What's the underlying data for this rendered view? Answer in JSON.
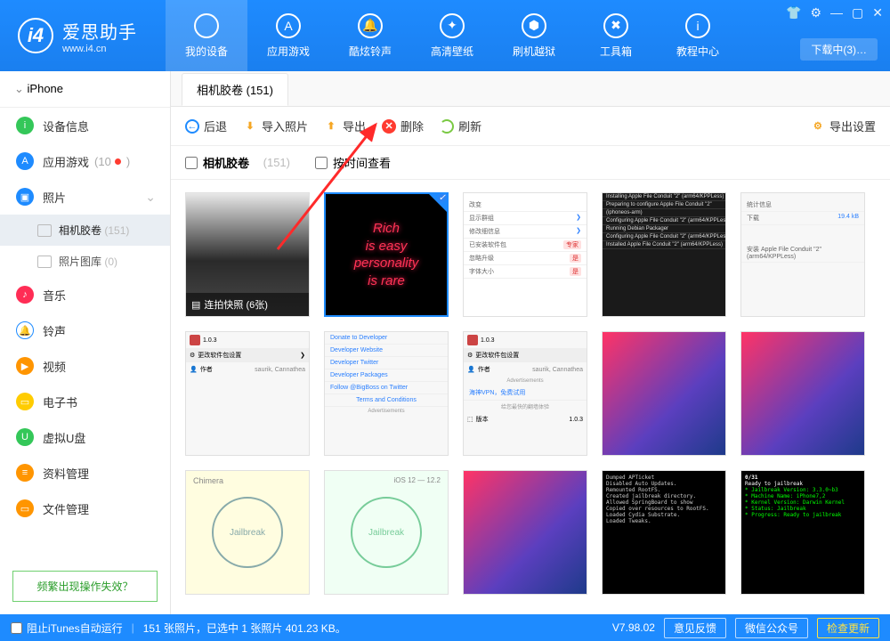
{
  "header": {
    "logo_badge": "i4",
    "logo_cn": "爱思助手",
    "logo_url": "www.i4.cn",
    "tabs": [
      {
        "label": "我的设备"
      },
      {
        "label": "应用游戏"
      },
      {
        "label": "酷炫铃声"
      },
      {
        "label": "高清壁纸"
      },
      {
        "label": "刷机越狱"
      },
      {
        "label": "工具箱"
      },
      {
        "label": "教程中心"
      }
    ],
    "download_pill": "下载中(3)…"
  },
  "sidebar": {
    "device": "iPhone",
    "items": [
      {
        "label": "设备信息",
        "color": "#34c759"
      },
      {
        "label": "应用游戏",
        "color": "#1e8bff",
        "count": "10",
        "dot": true
      },
      {
        "label": "照片",
        "color": "#1e8bff",
        "expandable": true
      },
      {
        "label": "音乐",
        "color": "#ff2d55"
      },
      {
        "label": "铃声",
        "color": "#1e8bff"
      },
      {
        "label": "视频",
        "color": "#ff9500"
      },
      {
        "label": "电子书",
        "color": "#ffcc00"
      },
      {
        "label": "虚拟U盘",
        "color": "#34c759"
      },
      {
        "label": "资料管理",
        "color": "#ff9500"
      },
      {
        "label": "文件管理",
        "color": "#ff9500"
      }
    ],
    "subs": [
      {
        "label": "相机胶卷",
        "count": "(151)",
        "active": true
      },
      {
        "label": "照片图库",
        "count": "(0)"
      }
    ],
    "help": "频繁出现操作失效？"
  },
  "main": {
    "tab": "相机胶卷 (151)",
    "toolbar": {
      "back": "后退",
      "import": "导入照片",
      "export": "导出",
      "delete": "删除",
      "refresh": "刷新",
      "settings": "导出设置"
    },
    "checks": {
      "all_label": "相机胶卷",
      "all_count": "(151)",
      "by_time": "按时间查看"
    },
    "burst": "连拍快照 (6张)",
    "neon": [
      "Rich",
      "is easy",
      "personality",
      "is rare"
    ],
    "thumb_cydia_links": [
      "Donate to Developer",
      "Developer Website",
      "Developer Twitter",
      "Developer Packages",
      "Follow @BigBoss on Twitter",
      "Terms and Conditions"
    ],
    "thumb_cydia_ad": "Advertisements",
    "thumb_vpn": "海神VPN，免费试用",
    "thumb_vpn_sub": "给您最快的翻墙体验",
    "thumb_cydia_ver": "1.0.3",
    "thumb_cydia_author": "saurik, Cannathea",
    "thumb_cydia_header": "更改软件包设置",
    "thumb_cydia_author_label": "作者",
    "thumb_cydia_version_label": "版本",
    "thumb_jailbreak": "Jailbreak",
    "thumb_chimera": "Chimera",
    "thumb_ios_ver": "iOS 12 — 12.2",
    "thumb_term_ready": "Ready to jailbreak",
    "thumb_term_031": "0/31",
    "settings_title": "统计信息",
    "settings_dl": "下载",
    "settings_size": "19.4 kB",
    "settings_install": "安装 Apple File Conduit \"2\" (arm64/KPPLess)"
  },
  "footer": {
    "itunes": "阻止iTunes自动运行",
    "status": "151 张照片，已选中 1 张照片 401.23 KB。",
    "version": "V7.98.02",
    "btn_feedback": "意见反馈",
    "btn_wechat": "微信公众号",
    "btn_update": "检查更新"
  }
}
